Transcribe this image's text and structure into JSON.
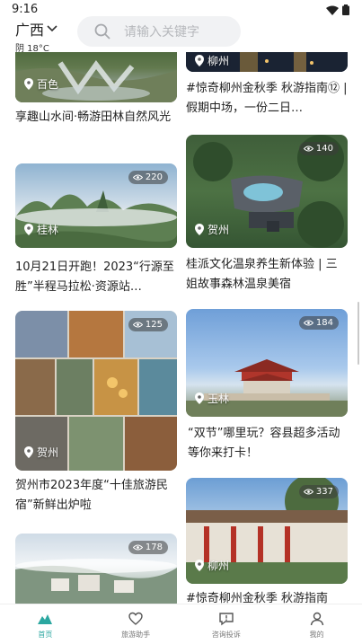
{
  "status_bar": {
    "time": "9:16"
  },
  "header": {
    "city": "广西",
    "weather": "阴 18°C",
    "search_placeholder": "请输入关键字"
  },
  "feed": {
    "cards": [
      {
        "id": "c1",
        "location": "百色",
        "views": "",
        "title": "享趣山水间·畅游田林自然风光"
      },
      {
        "id": "c2",
        "location": "柳州",
        "views": "",
        "title": "#惊奇柳州金秋季 秋游指南⑫ | 假期中场，一份二日…"
      },
      {
        "id": "c3",
        "location": "桂林",
        "views": "220",
        "title": "10月21日开跑！2023“行源至胜”半程马拉松·资源站…"
      },
      {
        "id": "c4",
        "location": "贺州",
        "views": "140",
        "title": "桂派文化温泉养生新体验 | 三姐故事森林温泉美宿"
      },
      {
        "id": "c5",
        "location": "贺州",
        "views": "125",
        "title": "贺州市2023年度“十佳旅游民宿”新鲜出炉啦"
      },
      {
        "id": "c6",
        "location": "玉林",
        "views": "184",
        "title": "“双节”哪里玩？容县超多活动等你来打卡！"
      },
      {
        "id": "c7",
        "location": "",
        "views": "178",
        "title": ""
      },
      {
        "id": "c8",
        "location": "柳州",
        "views": "337",
        "title": "#惊奇柳州金秋季 秋游指南"
      }
    ]
  },
  "tabbar": {
    "tabs": [
      {
        "label": "首页",
        "active": true
      },
      {
        "label": "旅游助手",
        "active": false
      },
      {
        "label": "咨询投诉",
        "active": false
      },
      {
        "label": "我的",
        "active": false
      }
    ]
  },
  "colors": {
    "accent": "#2ba7a0"
  }
}
